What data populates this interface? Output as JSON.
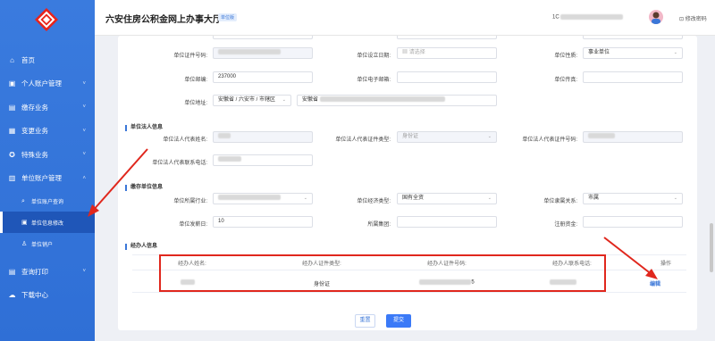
{
  "header": {
    "title": "六安住房公积金网上办事大厅",
    "badge": "单位版",
    "user_prefix": "1C",
    "change_password": "修改密码"
  },
  "sidebar": {
    "items": [
      {
        "label": "首页"
      },
      {
        "label": "个人账户管理"
      },
      {
        "label": "缴存业务"
      },
      {
        "label": "变更业务"
      },
      {
        "label": "特殊业务"
      },
      {
        "label": "单位账户管理"
      }
    ],
    "sub_items": [
      {
        "label": "单位账户查询"
      },
      {
        "label": "单位信息修改"
      },
      {
        "label": "单位销户"
      }
    ],
    "bottom_items": [
      {
        "label": "查询打印"
      },
      {
        "label": "下载中心"
      }
    ]
  },
  "form": {
    "unit_cert_no_label": "单位证件号码:",
    "setup_date_label": "单位设立日期:",
    "setup_date_placeholder": "请选择",
    "unit_nature_label": "单位性质:",
    "unit_nature_value": "事业单位",
    "postcode_label": "单位邮编:",
    "postcode_value": "237000",
    "email_label": "单位电子邮箱:",
    "fax_label": "单位传真:",
    "address_label": "单位地址:",
    "address_region": "安徽省 / 六安市 / 市辖区",
    "address_detail_prefix": "安徽省"
  },
  "legal": {
    "section": "单位法人信息",
    "name_label": "单位法人代表姓名:",
    "cert_type_label": "单位法人代表证件类型:",
    "cert_type_value": "身份证",
    "cert_no_label": "单位法人代表证件号码:",
    "phone_label": "单位法人代表联系电话:"
  },
  "deposit": {
    "section": "缴存单位信息",
    "industry_label": "单位所属行业:",
    "econ_type_label": "单位经济类型:",
    "econ_type_value": "国有全资",
    "affiliation_label": "单位隶属关系:",
    "affiliation_value": "市属",
    "pay_day_label": "单位发薪日:",
    "pay_day_value": "10",
    "group_label": "所属集团:",
    "capital_label": "注册资金:"
  },
  "handler": {
    "section": "经办人信息",
    "columns": [
      "经办人姓名:",
      "经办人证件类型:",
      "经办人证件号码:",
      "经办人联系电话:",
      "操作"
    ],
    "row": {
      "cert_type": "身份证",
      "cert_no_suffix": "5",
      "action": "编辑"
    }
  },
  "buttons": {
    "reset": "重置",
    "submit": "提交"
  },
  "colors": {
    "sidebar": "#2f6fd6",
    "accent": "#3b77d8",
    "highlight": "#e0271d"
  }
}
